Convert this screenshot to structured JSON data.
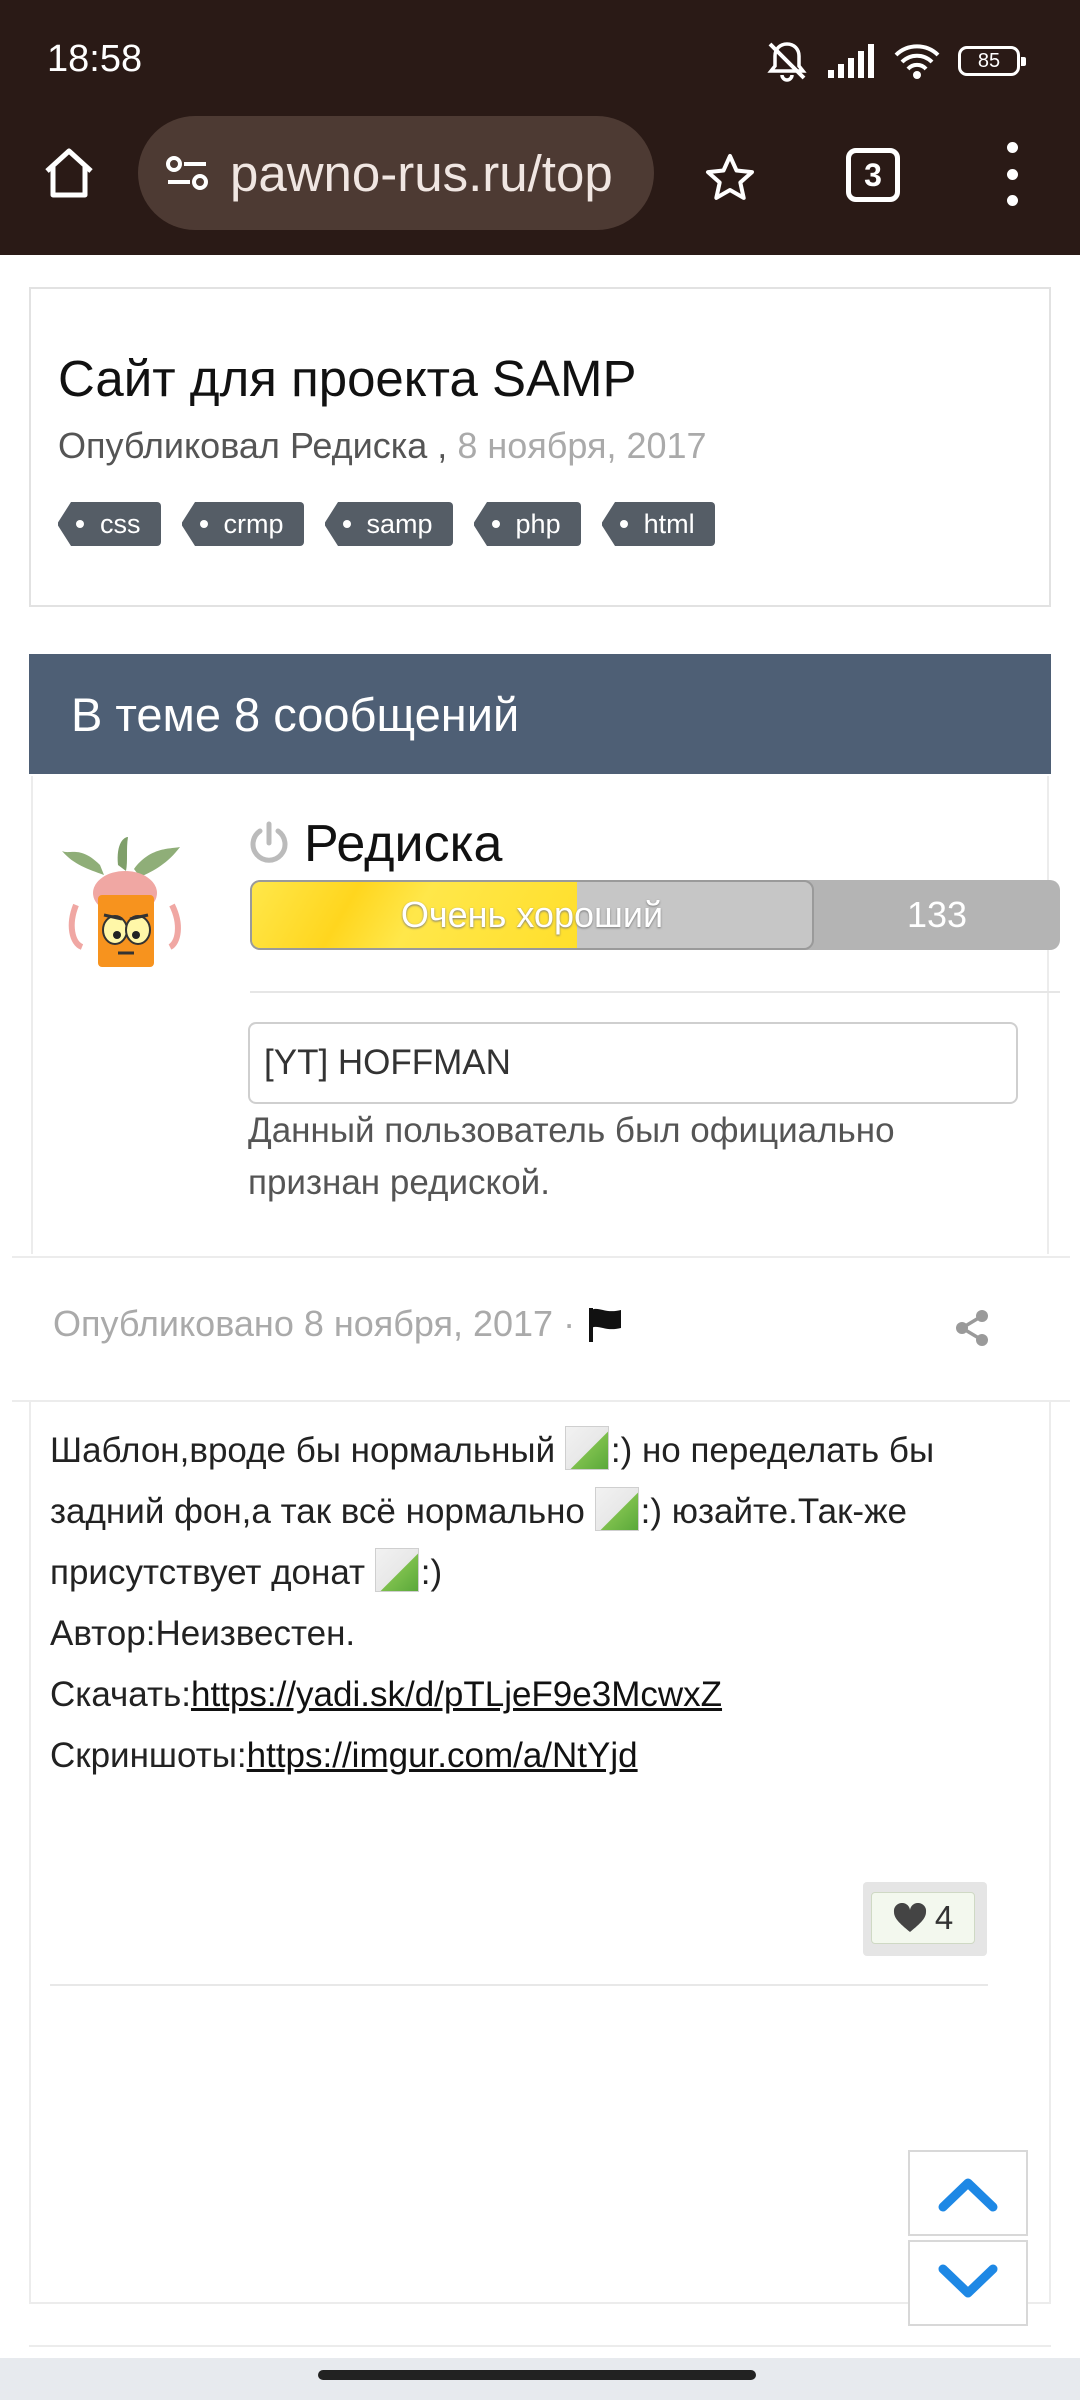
{
  "status_bar": {
    "time": "18:58",
    "battery": "85"
  },
  "browser": {
    "url": "pawno-rus.ru/top",
    "tab_count": "3"
  },
  "topic": {
    "title": "Сайт для проекта SAMP",
    "published_by": "Опубликовал Редиска ,",
    "published_date": "8 ноября, 2017",
    "tags": [
      "css",
      "crmp",
      "samp",
      "php",
      "html"
    ]
  },
  "section": {
    "header": "В теме 8 сообщений"
  },
  "author": {
    "name": "Редиска",
    "reputation_label": "Очень хороший",
    "reputation_count": "133",
    "reputation_fill": 0.58,
    "signature": "[YT] HOFFMAN",
    "note": "Данный пользователь был официально признан редиской."
  },
  "post": {
    "date": "Опубликовано 8 ноября, 2017 ·",
    "line1_a": "Шаблон,вроде бы нормальный ",
    "line1_b": ":) но переделать бы задний фон,а так всё нормально ",
    "line1_c": ":) юзайте.Так-же присутствует донат ",
    "line1_d": ":)",
    "author_line": "Автор:Неизвестен.",
    "download_label": "Скачать:",
    "download_url": "https://yadi.sk/d/pTLjeF9e3McwxZ",
    "screens_label": "Скриншоты:",
    "screens_url": "https://imgur.com/a/NtYjd",
    "likes": "4"
  },
  "icons": {
    "home": "home-icon",
    "site": "site-settings-icon",
    "star": "star-icon",
    "tabs": "tabs-icon",
    "menu": "more-vert-icon",
    "power": "power-icon",
    "flag": "flag-icon",
    "share": "share-icon",
    "heart": "heart-icon",
    "up": "chevron-up-icon",
    "down": "chevron-down-icon"
  },
  "colors": {
    "chrome": "#2a1a16",
    "header": "#4e5f75",
    "tag": "#555d66",
    "rep_fill": "#ffe74a",
    "accent_blue": "#1e88e5"
  }
}
